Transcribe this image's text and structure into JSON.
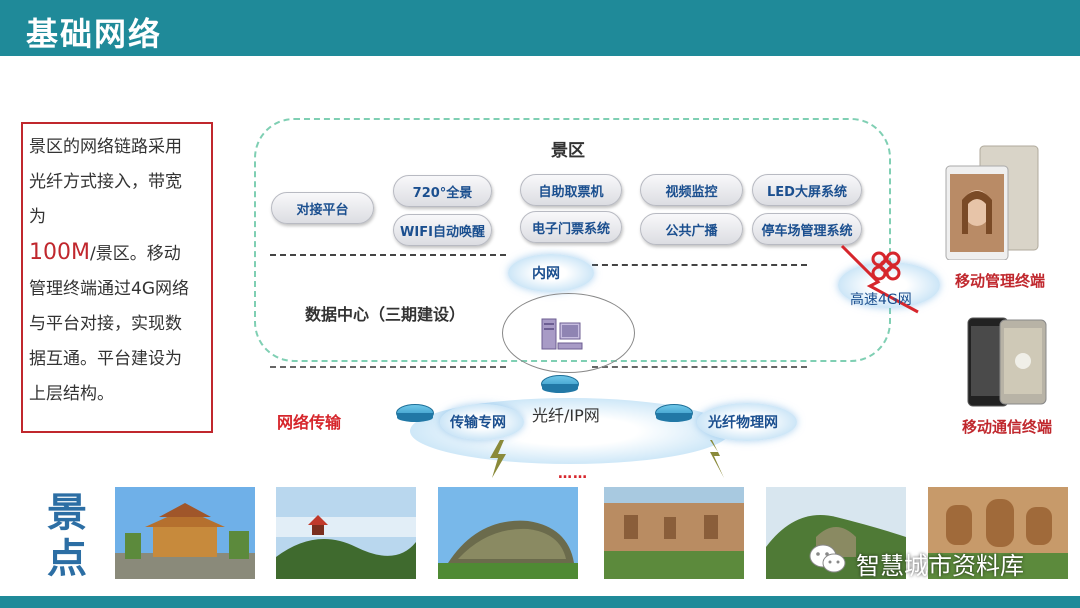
{
  "header": {
    "title": "基础网络"
  },
  "description": {
    "line1": "景区的网络链路采用",
    "line2": "光纤方式接入，带宽",
    "line3": "为",
    "highlight": "100M",
    "line4_rest": "/景区。移动",
    "line5": "管理终端通过4G网络",
    "line6": "与平台对接，实现数",
    "line7": "据互通。平台建设为",
    "line8": "上层结构。"
  },
  "scenic_area": {
    "title": "景区",
    "systems": [
      "对接平台",
      "720°全景",
      "WIFI自动唤醒",
      "自助取票机",
      "电子门票系统",
      "视频监控",
      "公共广播",
      "LED大屏系统",
      "停车场管理系统"
    ]
  },
  "intranet": {
    "label": "内网"
  },
  "data_center": {
    "title": "数据中心（三期建设）"
  },
  "network": {
    "transport_label": "网络传输",
    "fiber_ip": "光纤/IP网",
    "dedicated": "传输专网",
    "physical": "光纤物理网",
    "dots": "……",
    "mobile_4g": "高速4G网"
  },
  "terminals": {
    "management": "移动管理终端",
    "communication": "移动通信终端"
  },
  "scenic_spots": {
    "label_line1": "景",
    "label_line2": "点"
  },
  "watermark": {
    "text": "智慧城市资料库"
  },
  "colors": {
    "header": "#1f8a99",
    "accent_red": "#c0272d",
    "frame_dash": "#7fcfb3",
    "pill_text": "#1b4f8f",
    "spot_label": "#2c6ea4"
  },
  "icons": [
    "china-unicom-logo-icon",
    "server-computer-icon",
    "router-icon",
    "lightning-bolt-icon",
    "wechat-icon",
    "tablet-device-icon",
    "smartphone-device-icon"
  ]
}
